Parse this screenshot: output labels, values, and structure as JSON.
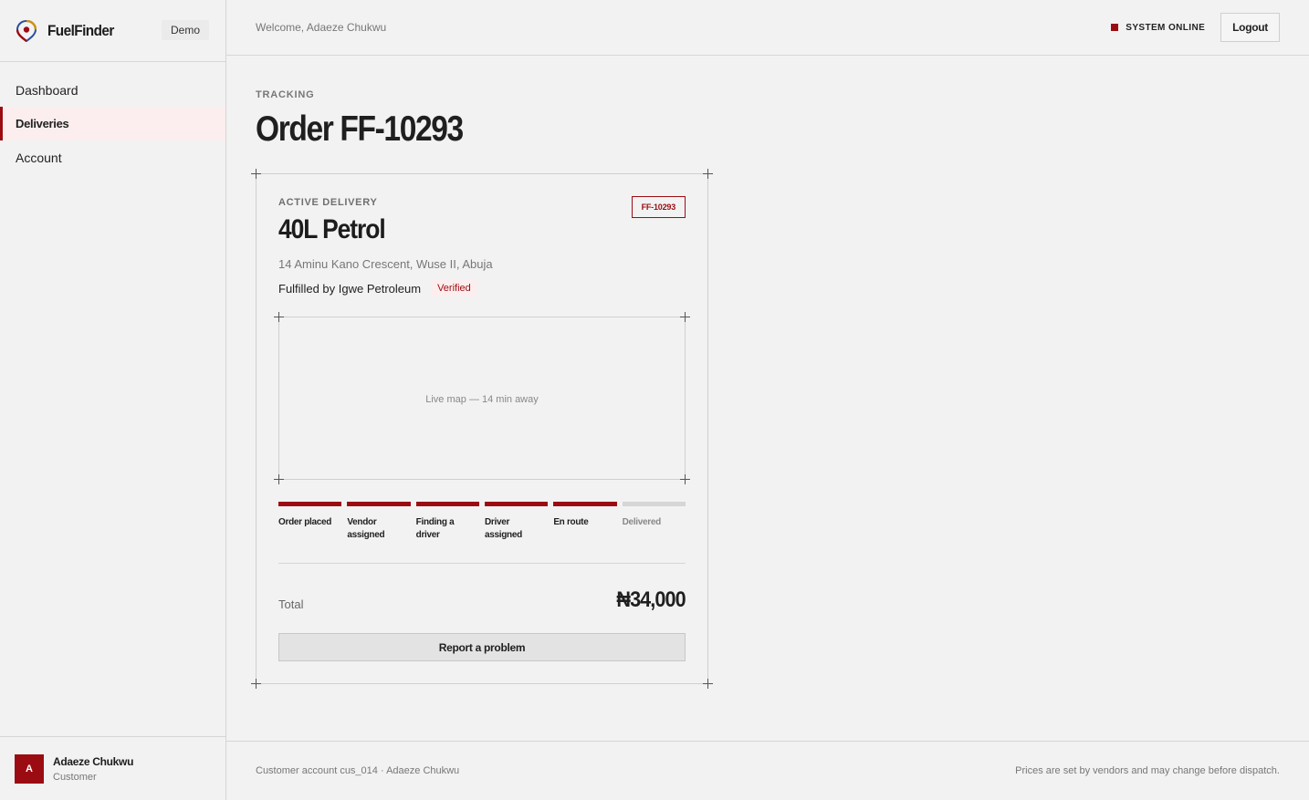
{
  "brand": {
    "name": "FuelFinder",
    "badge": "Demo"
  },
  "sidebar": {
    "items": [
      {
        "label": "Dashboard",
        "active": false
      },
      {
        "label": "Deliveries",
        "active": true
      },
      {
        "label": "Account",
        "active": false
      }
    ],
    "user": {
      "initial": "A",
      "name": "Adaeze Chukwu",
      "role": "Customer"
    }
  },
  "header": {
    "welcome": "Welcome, Adaeze Chukwu",
    "status": "SYSTEM ONLINE",
    "logout": "Logout"
  },
  "page": {
    "eyebrow": "TRACKING",
    "title": "Order FF-10293"
  },
  "order": {
    "eyebrow": "ACTIVE DELIVERY",
    "id_tag": "FF-10293",
    "product": "40L Petrol",
    "address": "14 Aminu Kano Crescent, Wuse II, Abuja",
    "fulfilled_by": "Fulfilled by Igwe Petroleum",
    "vendor_badge": "Verified",
    "map_label": "Live map — 14 min away",
    "steps": [
      {
        "label": "Order placed",
        "done": true
      },
      {
        "label": "Vendor assigned",
        "done": true
      },
      {
        "label": "Finding a driver",
        "done": true
      },
      {
        "label": "Driver assigned",
        "done": true
      },
      {
        "label": "En route",
        "done": true
      },
      {
        "label": "Delivered",
        "done": false
      }
    ],
    "total_label": "Total",
    "total_value": "₦34,000",
    "report_button": "Report a problem"
  },
  "footer": {
    "left": "Customer account cus_014 · Adaeze Chukwu",
    "right": "Prices are set by vendors and may change before dispatch."
  },
  "colors": {
    "accent": "#9b0c12",
    "background": "#f2f2f2"
  }
}
